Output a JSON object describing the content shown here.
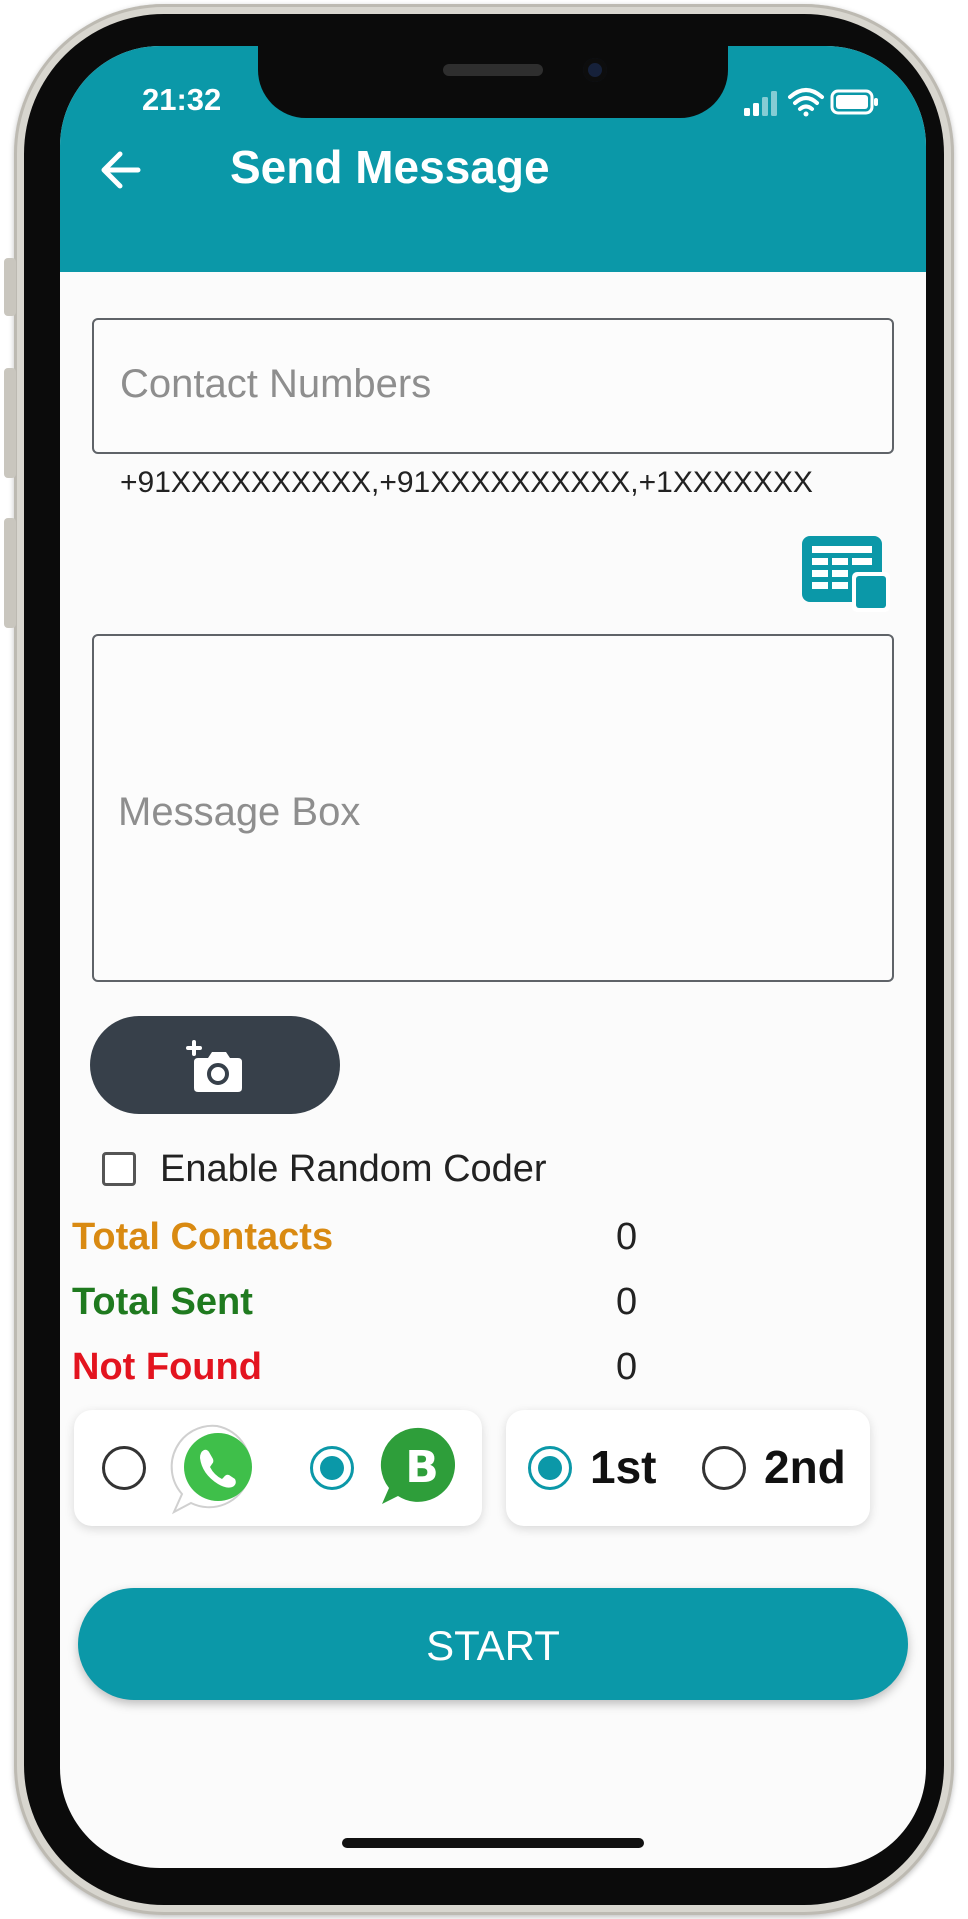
{
  "status_bar": {
    "time": "21:32",
    "icons": [
      "signal-icon",
      "wifi-icon",
      "battery-icon"
    ]
  },
  "header": {
    "back_icon": "arrow-left-icon",
    "title": "Send Message"
  },
  "contact_field": {
    "placeholder": "Contact Numbers",
    "value": "",
    "helper": "+91XXXXXXXXXX,+91XXXXXXXXXX,+1XXXXXXX"
  },
  "import_icon": "spreadsheet-import-icon",
  "message_field": {
    "placeholder": "Message Box",
    "value": ""
  },
  "attach_icon": "add-photo-camera-icon",
  "random_coder": {
    "label": "Enable Random Coder",
    "checked": false
  },
  "stats": [
    {
      "label": "Total Contacts",
      "value": "0",
      "color": "#d98a12"
    },
    {
      "label": "Total Sent",
      "value": "0",
      "color": "#1f7a1f"
    },
    {
      "label": "Not Found",
      "value": "0",
      "color": "#e3141f"
    }
  ],
  "app_choice": {
    "options": [
      {
        "icon": "whatsapp-icon",
        "selected": false
      },
      {
        "icon": "whatsapp-business-icon",
        "selected": true
      }
    ]
  },
  "sim_choice": {
    "options": [
      {
        "label": "1st",
        "selected": true
      },
      {
        "label": "2nd",
        "selected": false
      }
    ]
  },
  "start_button": {
    "label": "START"
  },
  "colors": {
    "primary": "#0b98a8",
    "attach_button": "#37404a",
    "whatsapp_green": "#3fbf4a",
    "business_green": "#2e9e3a"
  }
}
